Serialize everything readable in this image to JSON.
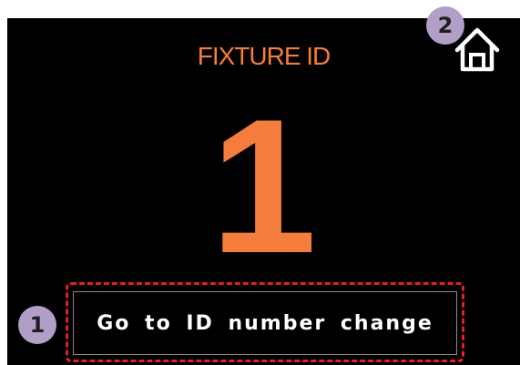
{
  "screen": {
    "title": "FIXTURE ID",
    "fixture_id_value": "1",
    "accent_color": "#f47c3c",
    "background_color": "#000000"
  },
  "home_button": {
    "icon": "home-icon"
  },
  "change_id_button": {
    "label": "Go to ID number change"
  },
  "annotations": {
    "marker_1": "1",
    "marker_2": "2",
    "marker_color": "#b19fc8",
    "highlight_color": "#e31e24"
  }
}
